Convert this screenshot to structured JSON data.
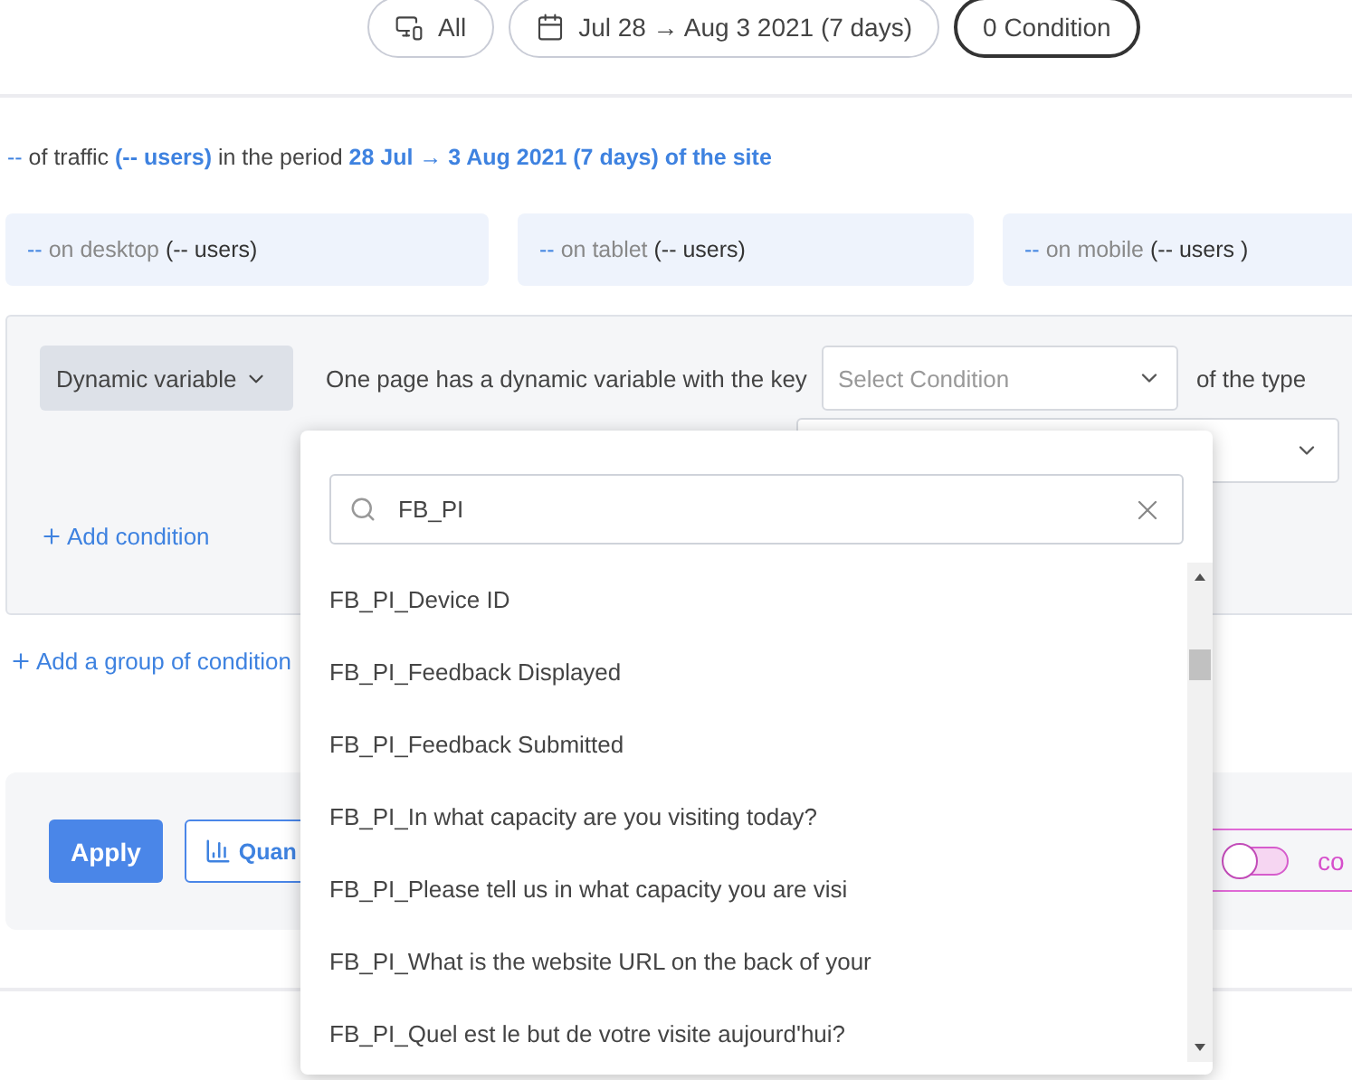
{
  "filters": [
    {
      "kind": "device",
      "label": "All",
      "selected": false
    },
    {
      "kind": "date",
      "label": "Jul 28 → Aug 3 2021 (7 days)",
      "selected": false
    },
    {
      "kind": "conditions",
      "label": "0 Condition",
      "selected": true
    }
  ],
  "summary": [
    {
      "text": "--",
      "highlight": true,
      "bold": false
    },
    {
      "text": " of traffic ",
      "highlight": false,
      "bold": false
    },
    {
      "text": "(-- users)",
      "highlight": true,
      "bold": true
    },
    {
      "text": " in the period ",
      "highlight": false,
      "bold": false
    },
    {
      "text": "28 Jul → 3 Aug 2021 (7 days) of the site",
      "highlight": true,
      "bold": true
    }
  ],
  "cards": [
    {
      "value": "--",
      "label": "on desktop",
      "users": "(-- users)"
    },
    {
      "value": "--",
      "label": "on tablet",
      "users": "(-- users)"
    },
    {
      "value": "--",
      "label": "on mobile",
      "users": "(-- users )"
    }
  ],
  "condition": {
    "type_button": "Dynamic variable",
    "sentence": "One page has a dynamic variable with the key",
    "key_select": {
      "placeholder": "Select Condition"
    },
    "type_text": "of the type",
    "add_condition": "Add condition"
  },
  "add_group": "Add a group of condition",
  "actions": {
    "apply": "Apply",
    "secondary": "Quan",
    "toggle": {
      "on": false
    },
    "toggle_label": "co"
  },
  "dropdown": {
    "search": {
      "value": "FB_PI"
    },
    "options": [
      "FB_PI_Device ID",
      "FB_PI_Feedback Displayed",
      "FB_PI_Feedback Submitted",
      "FB_PI_In what capacity are you visiting today?",
      "FB_PI_Please tell us in what capacity you are visi",
      "FB_PI_What is the website URL on the back of your",
      "FB_PI_Quel est le but de votre visite aujourd'hui?"
    ]
  }
}
